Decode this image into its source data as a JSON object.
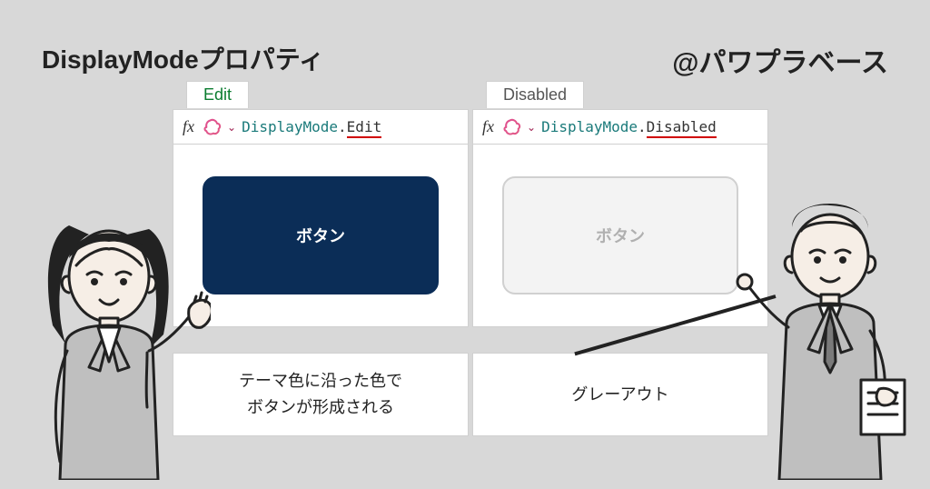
{
  "header": {
    "title": "DisplayModeプロパティ",
    "handle": "@パワプラベース"
  },
  "left": {
    "tab": "Edit",
    "formula_prefix": "DisplayMode",
    "formula_member": "Edit",
    "button_label": "ボタン",
    "caption": "テーマ色に沿った色で\nボタンが形成される"
  },
  "right": {
    "tab": "Disabled",
    "formula_prefix": "DisplayMode",
    "formula_member": "Disabled",
    "button_label": "ボタン",
    "caption": "グレーアウト"
  },
  "icons": {
    "fx": "fx",
    "chevron": "⌄"
  }
}
